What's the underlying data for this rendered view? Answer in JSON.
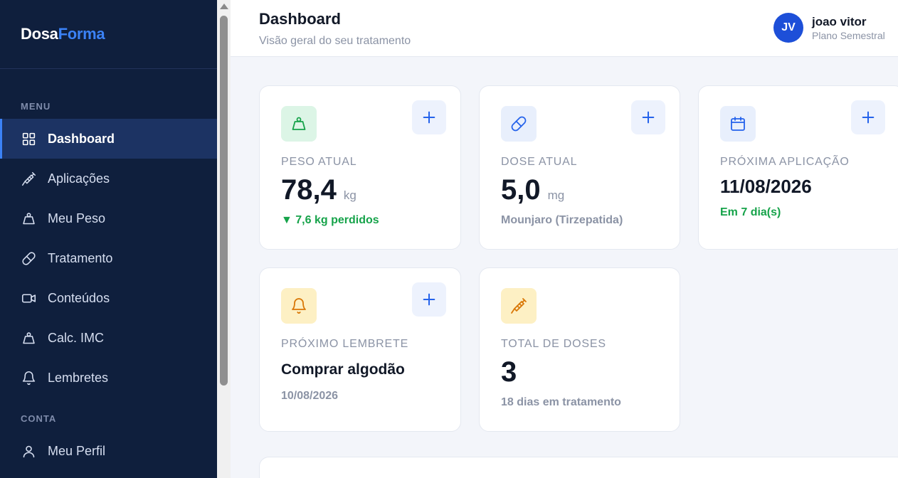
{
  "brand": {
    "part1": "Dosa",
    "part2": "Forma"
  },
  "sidebar": {
    "menu_label": "MENU",
    "items": [
      {
        "label": "Dashboard",
        "icon": "grid-icon",
        "active": true
      },
      {
        "label": "Aplicações",
        "icon": "syringe-icon"
      },
      {
        "label": "Meu Peso",
        "icon": "weight-icon"
      },
      {
        "label": "Tratamento",
        "icon": "pill-icon"
      },
      {
        "label": "Conteúdos",
        "icon": "video-icon"
      },
      {
        "label": "Calc. IMC",
        "icon": "weight-icon"
      },
      {
        "label": "Lembretes",
        "icon": "bell-icon"
      }
    ],
    "conta_label": "CONTA",
    "conta_items": [
      {
        "label": "Meu Perfil",
        "icon": "user-icon"
      }
    ]
  },
  "header": {
    "title": "Dashboard",
    "subtitle": "Visão geral do seu tratamento",
    "user": {
      "initials": "JV",
      "name": "joao vitor",
      "plan": "Plano Semestral"
    }
  },
  "cards": {
    "peso": {
      "label": "PESO ATUAL",
      "value": "78,4",
      "unit": "kg",
      "foot": "▼ 7,6 kg perdidos"
    },
    "dose": {
      "label": "DOSE ATUAL",
      "value": "5,0",
      "unit": "mg",
      "foot": "Mounjaro (Tirzepatida)"
    },
    "aplicacao": {
      "label": "PRÓXIMA APLICAÇÃO",
      "value": "11/08/2026",
      "foot": "Em 7 dia(s)"
    },
    "lembrete": {
      "label": "PRÓXIMO LEMBRETE",
      "value": "Comprar algodão",
      "foot": "10/08/2026"
    },
    "doses": {
      "label": "TOTAL DE DOSES",
      "value": "3",
      "foot": "18 dias em tratamento"
    }
  },
  "colors": {
    "sidebar_bg": "#0f1f3d",
    "accent": "#3b82f6",
    "primary": "#2563eb",
    "success": "#16a34a",
    "warning": "#d97706"
  }
}
